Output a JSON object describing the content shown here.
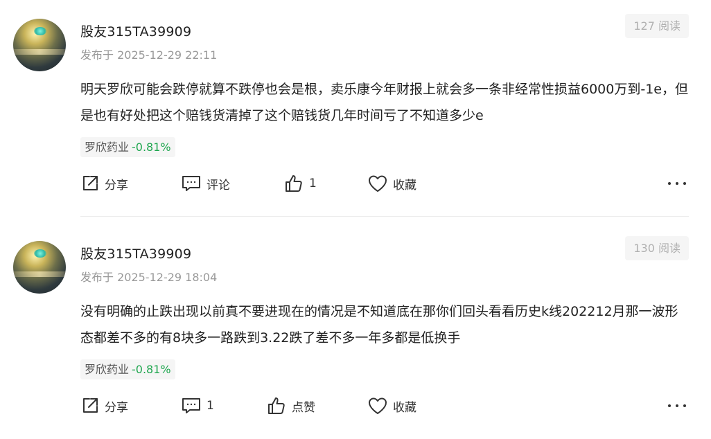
{
  "posts": [
    {
      "author": "股友315TA39909",
      "time": "发布于 2025-12-29 22:11",
      "reads": "127 阅读",
      "content": "明天罗欣可能会跌停就算不跌停也会是根，卖乐康今年财报上就会多一条非经常性损益6000万到-1e，但是也有好处把这个赔钱货清掉了这个赔钱货几年时间亏了不知道多少e",
      "stock": {
        "name": "罗欣药业",
        "change": "-0.81%"
      },
      "actions": {
        "share": "分享",
        "comment": "评论",
        "like": "1",
        "favorite": "收藏"
      }
    },
    {
      "author": "股友315TA39909",
      "time": "发布于 2025-12-29 18:04",
      "reads": "130 阅读",
      "content": "没有明确的止跌出现以前真不要进现在的情况是不知道底在那你们回头看看历史k线202212月那一波形态都差不多的有8块多一路跌到3.22跌了差不多一年多都是低换手",
      "stock": {
        "name": "罗欣药业",
        "change": "-0.81%"
      },
      "actions": {
        "share": "分享",
        "comment": "1",
        "like": "点赞",
        "favorite": "收藏"
      }
    }
  ],
  "colors": {
    "positive_change": "#1ea64e",
    "muted_text": "#999999",
    "badge_bg": "#f5f5f5"
  },
  "icons": [
    "avatar",
    "share-icon",
    "comment-icon",
    "thumbs-up-icon",
    "heart-icon",
    "more-icon"
  ]
}
